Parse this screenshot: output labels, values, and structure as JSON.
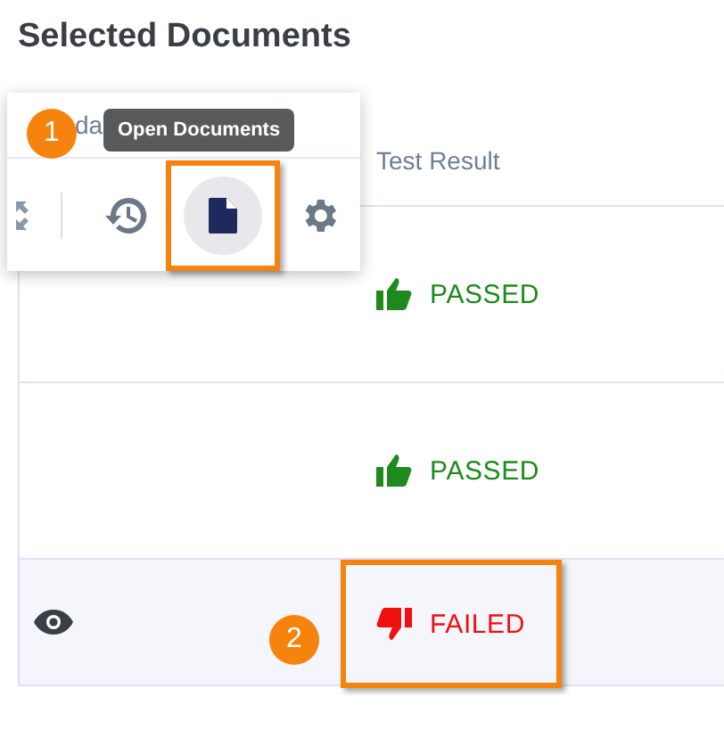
{
  "title": "Selected Documents",
  "table": {
    "columns": [
      {
        "label": "Test Result"
      }
    ],
    "rows": [
      {
        "kind": "passed",
        "viewable": false,
        "result": "PASSED",
        "highlighted": false
      },
      {
        "kind": "passed",
        "viewable": false,
        "result": "PASSED",
        "highlighted": false
      },
      {
        "kind": "failed",
        "viewable": true,
        "result": "FAILED",
        "highlighted": true,
        "callout": "2"
      }
    ]
  },
  "popup": {
    "header": "da",
    "callout": "1",
    "tooltip": "Open Documents",
    "tools": [
      {
        "kind": "expand",
        "selected": false
      },
      {
        "kind": "divider"
      },
      {
        "kind": "history",
        "selected": false
      },
      {
        "kind": "document",
        "selected": true,
        "highlighted": true
      },
      {
        "kind": "settings",
        "selected": false
      }
    ]
  }
}
